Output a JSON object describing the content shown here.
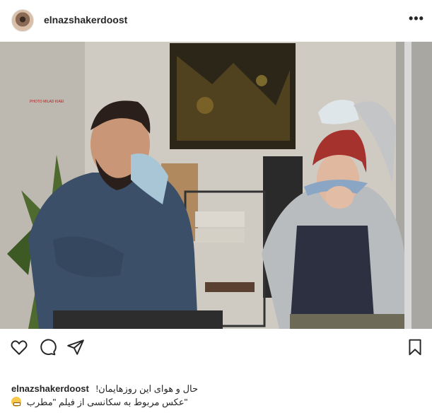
{
  "post": {
    "username": "elnazshakerdoost",
    "more_label": "•••"
  },
  "photo": {
    "watermark": "PHOTO MILAD KIAEI"
  },
  "actions": {
    "like_icon": "heart-icon",
    "comment_icon": "comment-icon",
    "share_icon": "send-icon",
    "save_icon": "bookmark-icon"
  },
  "caption": {
    "username": "elnazshakerdoost",
    "line1": "حال و هوای این روزهایمان!",
    "line2": "\"عکس مربوط به سکانسی از فیلم \"مطرب"
  }
}
